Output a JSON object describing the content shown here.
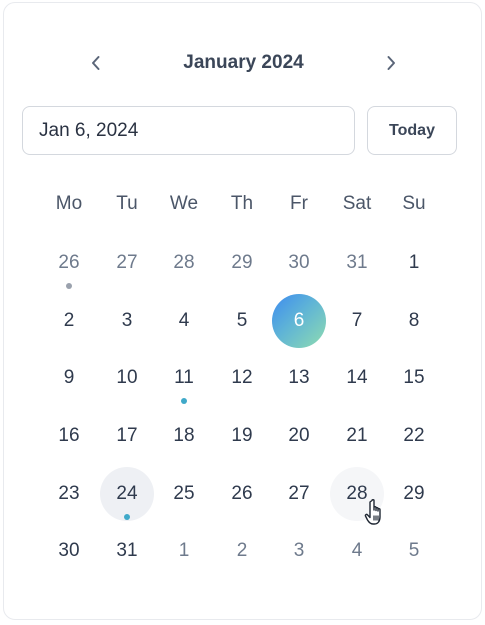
{
  "picker": {
    "month_title": "January 2024",
    "input_value": "Jan 6, 2024",
    "today_label": "Today",
    "prev_icon": "chevron-left-icon",
    "next_icon": "chevron-right-icon"
  },
  "weekdays": [
    "Mo",
    "Tu",
    "We",
    "Th",
    "Fr",
    "Sat",
    "Su"
  ],
  "weeks": [
    [
      {
        "label": "26",
        "muted": true,
        "dot": "gray"
      },
      {
        "label": "27",
        "muted": true
      },
      {
        "label": "28",
        "muted": true
      },
      {
        "label": "29",
        "muted": true
      },
      {
        "label": "30",
        "muted": true
      },
      {
        "label": "31",
        "muted": true
      },
      {
        "label": "1"
      }
    ],
    [
      {
        "label": "2"
      },
      {
        "label": "3"
      },
      {
        "label": "4"
      },
      {
        "label": "5"
      },
      {
        "label": "6",
        "selected": true
      },
      {
        "label": "7"
      },
      {
        "label": "8"
      }
    ],
    [
      {
        "label": "9"
      },
      {
        "label": "10"
      },
      {
        "label": "11",
        "dot": "accent"
      },
      {
        "label": "12"
      },
      {
        "label": "13"
      },
      {
        "label": "14"
      },
      {
        "label": "15"
      }
    ],
    [
      {
        "label": "16"
      },
      {
        "label": "17"
      },
      {
        "label": "18"
      },
      {
        "label": "19"
      },
      {
        "label": "20"
      },
      {
        "label": "21"
      },
      {
        "label": "22"
      }
    ],
    [
      {
        "label": "23"
      },
      {
        "label": "24",
        "today": true,
        "dot": "accent"
      },
      {
        "label": "25"
      },
      {
        "label": "26"
      },
      {
        "label": "27"
      },
      {
        "label": "28",
        "hover": true
      },
      {
        "label": "29"
      }
    ],
    [
      {
        "label": "30"
      },
      {
        "label": "31"
      },
      {
        "label": "1",
        "muted": true
      },
      {
        "label": "2",
        "muted": true
      },
      {
        "label": "3",
        "muted": true
      },
      {
        "label": "4",
        "muted": true
      },
      {
        "label": "5",
        "muted": true
      }
    ]
  ],
  "colors": {
    "dot_gray": "#9aa1ad",
    "dot_accent": "#3fa9c9",
    "selected_start": "#3d8bf0",
    "selected_end": "#8fdcb0"
  },
  "cursor_icon": "hand-pointer-icon"
}
